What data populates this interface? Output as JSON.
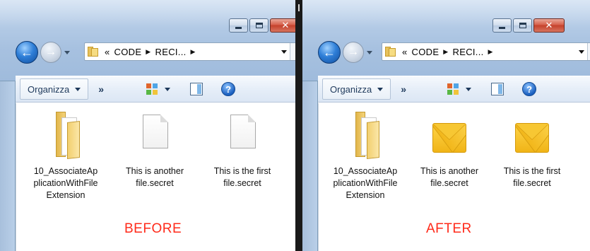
{
  "panes": [
    {
      "address": {
        "overflow": "«",
        "crumb1": "CODE",
        "crumb2": "RECI..."
      },
      "toolbar": {
        "organize": "Organizza",
        "more": "»",
        "help": "?"
      },
      "items": [
        {
          "type": "folder",
          "label": "10_AssociateApplicationWithFileExtension"
        },
        {
          "type": "blank",
          "label": "This is another file.secret"
        },
        {
          "type": "blank",
          "label": "This is the first file.secret"
        }
      ],
      "caption": "BEFORE"
    },
    {
      "address": {
        "overflow": "«",
        "crumb1": "CODE",
        "crumb2": "RECI..."
      },
      "toolbar": {
        "organize": "Organizza",
        "more": "»",
        "help": "?"
      },
      "items": [
        {
          "type": "folder",
          "label": "10_AssociateApplicationWithFileExtension"
        },
        {
          "type": "envelope",
          "label": "This is another file.secret"
        },
        {
          "type": "envelope",
          "label": "This is the first file.secret"
        }
      ],
      "caption": "AFTER"
    }
  ],
  "colors": {
    "caption": "#ff2a1a",
    "close_button": "#c4412c",
    "frame": "#b4cbe6"
  }
}
